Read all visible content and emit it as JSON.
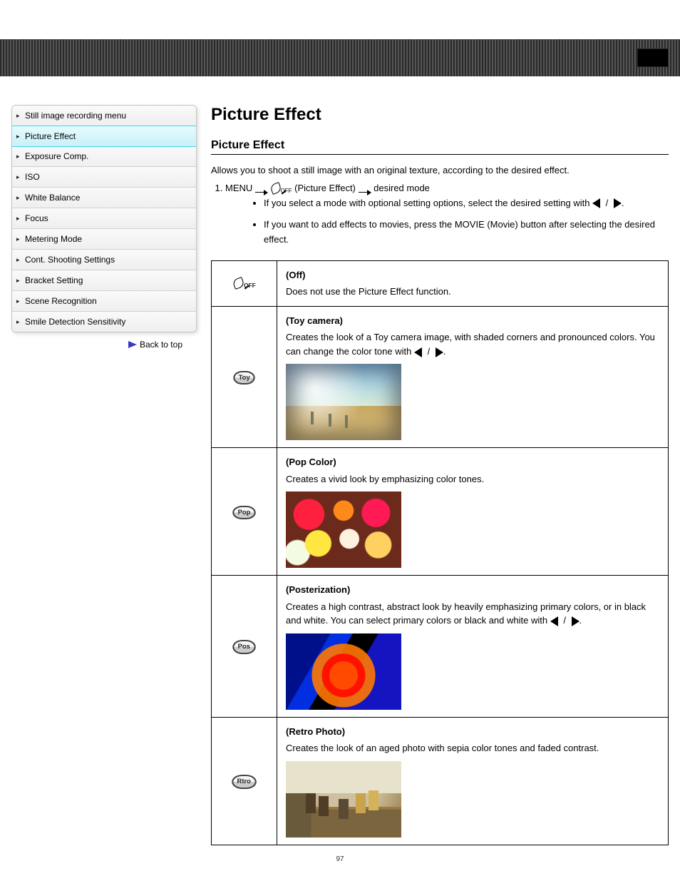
{
  "nav": {
    "items": [
      {
        "label": "Still image recording menu"
      },
      {
        "label": "Picture Effect"
      },
      {
        "label": "Exposure Comp."
      },
      {
        "label": "ISO"
      },
      {
        "label": "White Balance"
      },
      {
        "label": "Focus"
      },
      {
        "label": "Metering Mode"
      },
      {
        "label": "Cont. Shooting Settings"
      },
      {
        "label": "Bracket Setting"
      },
      {
        "label": "Scene Recognition"
      },
      {
        "label": "Smile Detection Sensitivity"
      }
    ],
    "activeIndex": 1,
    "back": "Back to top"
  },
  "heading": "Picture Effect",
  "subheading": "Picture Effect",
  "intro": {
    "lead": "Allows you to shoot a still image with an original texture, according to the desired effect.",
    "menuLine_prefix": "MENU",
    "menuLine_middle": "(Picture Effect)",
    "menuLine_suffix": "desired mode",
    "bullets": [
      {
        "pre": "If you select a mode with optional setting options, select the desired setting with ",
        "post": "."
      },
      {
        "text": "If you want to add effects to movies, press the MOVIE (Movie) button after selecting the desired effect."
      }
    ]
  },
  "table": [
    {
      "icon": "off",
      "title": "(Off)",
      "desc": "Does not use the Picture Effect function."
    },
    {
      "icon": "Toy",
      "title": "(Toy camera)",
      "desc_pre": "Creates the look of a Toy camera image, with shaded corners and pronounced colors. You can change the color tone with ",
      "desc_post": ".",
      "thumbClass": "thumb-windmill"
    },
    {
      "icon": "Pop",
      "title": "(Pop Color)",
      "desc": "Creates a vivid look by emphasizing color tones.",
      "thumbClass": "thumb-flowers"
    },
    {
      "icon": "Pos",
      "title": "(Posterization)",
      "desc_pre": "Creates a high contrast, abstract look by heavily emphasizing primary colors, or in black and white. You can select primary colors or black and white with ",
      "desc_post": ".",
      "thumbClass": "thumb-poster"
    },
    {
      "icon": "Rtro",
      "title": "(Retro Photo)",
      "desc": "Creates the look of an aged photo with sepia color tones and faded contrast.",
      "thumbClass": "thumb-retro"
    }
  ],
  "pageNumber": "97"
}
